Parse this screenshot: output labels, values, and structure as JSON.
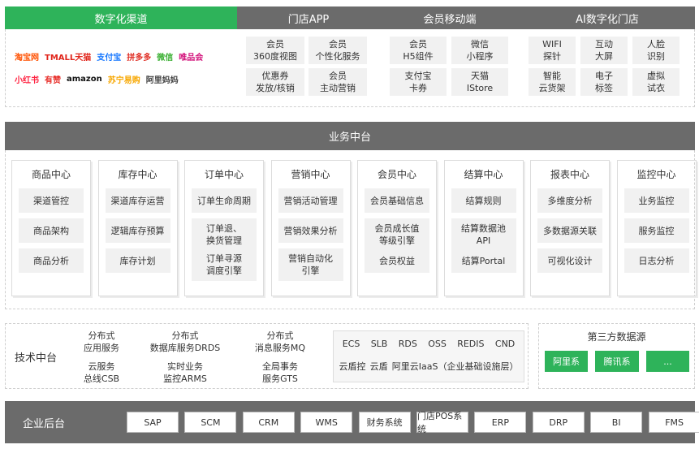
{
  "tabs": [
    "数字化渠道",
    "门店APP",
    "会员移动端",
    "AI数字化门店"
  ],
  "channel_logos": [
    {
      "text": "淘宝网",
      "color": "#ff5000"
    },
    {
      "text": "TMALL天猫",
      "color": "#e1251b"
    },
    {
      "text": "支付宝",
      "color": "#1677ff"
    },
    {
      "text": "拼多多",
      "color": "#e02e24"
    },
    {
      "text": "微信",
      "color": "#3cb034"
    },
    {
      "text": "唯品会",
      "color": "#d3137b"
    },
    {
      "text": "小红书",
      "color": "#ff2442"
    },
    {
      "text": "有赞",
      "color": "#e8312c"
    },
    {
      "text": "amazon",
      "color": "#111111"
    },
    {
      "text": "苏宁易购",
      "color": "#f7a700"
    },
    {
      "text": "阿里妈妈",
      "color": "#444444"
    }
  ],
  "store_app": [
    "会员\n360度视图",
    "会员\n个性化服务",
    "优惠券\n发放/核销",
    "会员\n主动营销"
  ],
  "member_mobile": [
    "会员\nH5组件",
    "微信\n小程序",
    "支付宝\n卡券",
    "天猫\nIStore"
  ],
  "ai_store": [
    "WIFI\n探针",
    "互动\n大屏",
    "人脸\n识别",
    "智能\n云货架",
    "电子\n标签",
    "虚拟\n试衣"
  ],
  "business_platform": {
    "title": "业务中台",
    "columns": [
      {
        "title": "商品中心",
        "items": [
          "渠道管控",
          "商品架构",
          "商品分析"
        ]
      },
      {
        "title": "库存中心",
        "items": [
          "渠道库存运营",
          "逻辑库存预算",
          "库存计划"
        ]
      },
      {
        "title": "订单中心",
        "items": [
          "订单生命周期",
          "订单退、\n换货管理",
          "订单寻源\n调度引擎"
        ]
      },
      {
        "title": "营销中心",
        "items": [
          "营销活动管理",
          "营销效果分析",
          "营销自动化\n引擎"
        ]
      },
      {
        "title": "会员中心",
        "items": [
          "会员基础信息",
          "会员成长值\n等级引擎",
          "会员权益"
        ]
      },
      {
        "title": "结算中心",
        "items": [
          "结算规则",
          "结算数据池\nAPI",
          "结算Portal"
        ]
      },
      {
        "title": "报表中心",
        "items": [
          "多维度分析",
          "多数据源关联",
          "可视化设计"
        ]
      },
      {
        "title": "监控中心",
        "items": [
          "业务监控",
          "服务监控",
          "日志分析"
        ]
      }
    ]
  },
  "tech_platform": {
    "title": "技术中台",
    "services": [
      "分布式\n应用服务",
      "分布式\n数据库服务DRDS",
      "分布式\n消息服务MQ",
      "云服务\n总线CSB",
      "实时业务\n监控ARMS",
      "全局事务\n服务GTS"
    ],
    "cloud": [
      "ECS",
      "SLB",
      "RDS",
      "OSS",
      "REDIS",
      "CND"
    ],
    "cloud_row2": [
      "云盾控",
      "云盾",
      "阿里云IaaS（企业基础设施层）"
    ]
  },
  "third_party": {
    "title": "第三方数据源",
    "items": [
      "阿里系",
      "腾讯系",
      "..."
    ]
  },
  "backend": {
    "title": "企业后台",
    "items": [
      "SAP",
      "SCM",
      "CRM",
      "WMS",
      "财务系统",
      "门店POS系统",
      "ERP",
      "DRP",
      "BI",
      "FMS"
    ]
  },
  "colors": {
    "green": "#2eb35a",
    "gray_tab": "#6b6b6b",
    "cell": "#f1f1f1"
  }
}
